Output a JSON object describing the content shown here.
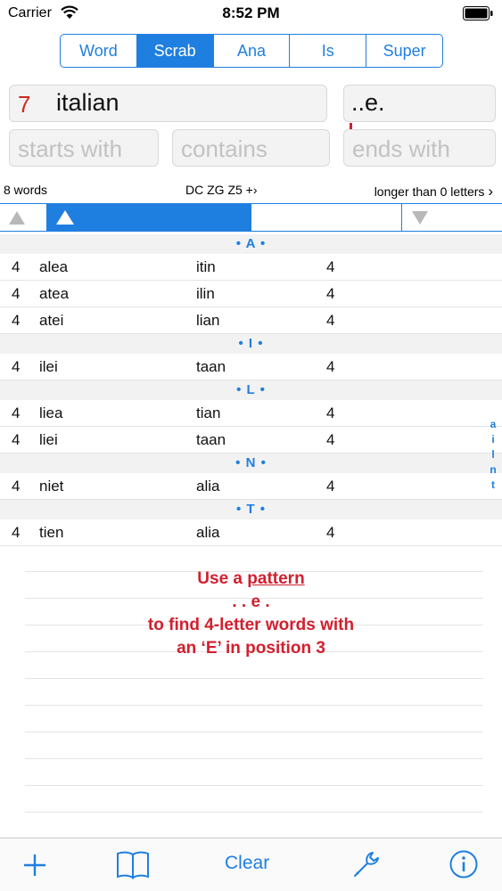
{
  "status": {
    "carrier": "Carrier",
    "time": "8:52 PM"
  },
  "tabs": [
    "Word",
    "Scrab",
    "Ana",
    "Is",
    "Super"
  ],
  "active_tab": "Scrab",
  "main_input": {
    "count": "7",
    "word": "italian",
    "pattern": "..e."
  },
  "filters": {
    "starts_placeholder": "starts with",
    "contains_placeholder": "contains",
    "ends_placeholder": "ends with"
  },
  "info": {
    "word_count": "8 words",
    "dict": "DC ZG  Z5 +",
    "length_filter": "longer than 0 letters"
  },
  "sections": [
    {
      "letter": "• A •",
      "rows": [
        {
          "len": "4",
          "word": "alea",
          "left": "itin",
          "left_len": "4"
        },
        {
          "len": "4",
          "word": "atea",
          "left": "ilin",
          "left_len": "4"
        },
        {
          "len": "4",
          "word": "atei",
          "left": "lian",
          "left_len": "4"
        }
      ]
    },
    {
      "letter": "• I •",
      "rows": [
        {
          "len": "4",
          "word": "ilei",
          "left": "taan",
          "left_len": "4"
        }
      ]
    },
    {
      "letter": "• L •",
      "rows": [
        {
          "len": "4",
          "word": "liea",
          "left": "tian",
          "left_len": "4"
        },
        {
          "len": "4",
          "word": "liei",
          "left": "taan",
          "left_len": "4"
        }
      ]
    },
    {
      "letter": "• N •",
      "rows": [
        {
          "len": "4",
          "word": "niet",
          "left": "alia",
          "left_len": "4"
        }
      ]
    },
    {
      "letter": "• T •",
      "rows": [
        {
          "len": "4",
          "word": "tien",
          "left": "alia",
          "left_len": "4"
        }
      ]
    }
  ],
  "index_letters": [
    "a",
    "i",
    "l",
    "n",
    "t"
  ],
  "hint": {
    "line1_pre": "Use a ",
    "line1_u": "pattern",
    "line2": ". . e .",
    "line3": "to find 4-letter words with",
    "line4": "an ‘E’ in position 3"
  },
  "toolbar": {
    "clear": "Clear"
  },
  "colors": {
    "accent": "#1f7fe0",
    "hint": "#d21f2e",
    "count": "#d0291f"
  }
}
